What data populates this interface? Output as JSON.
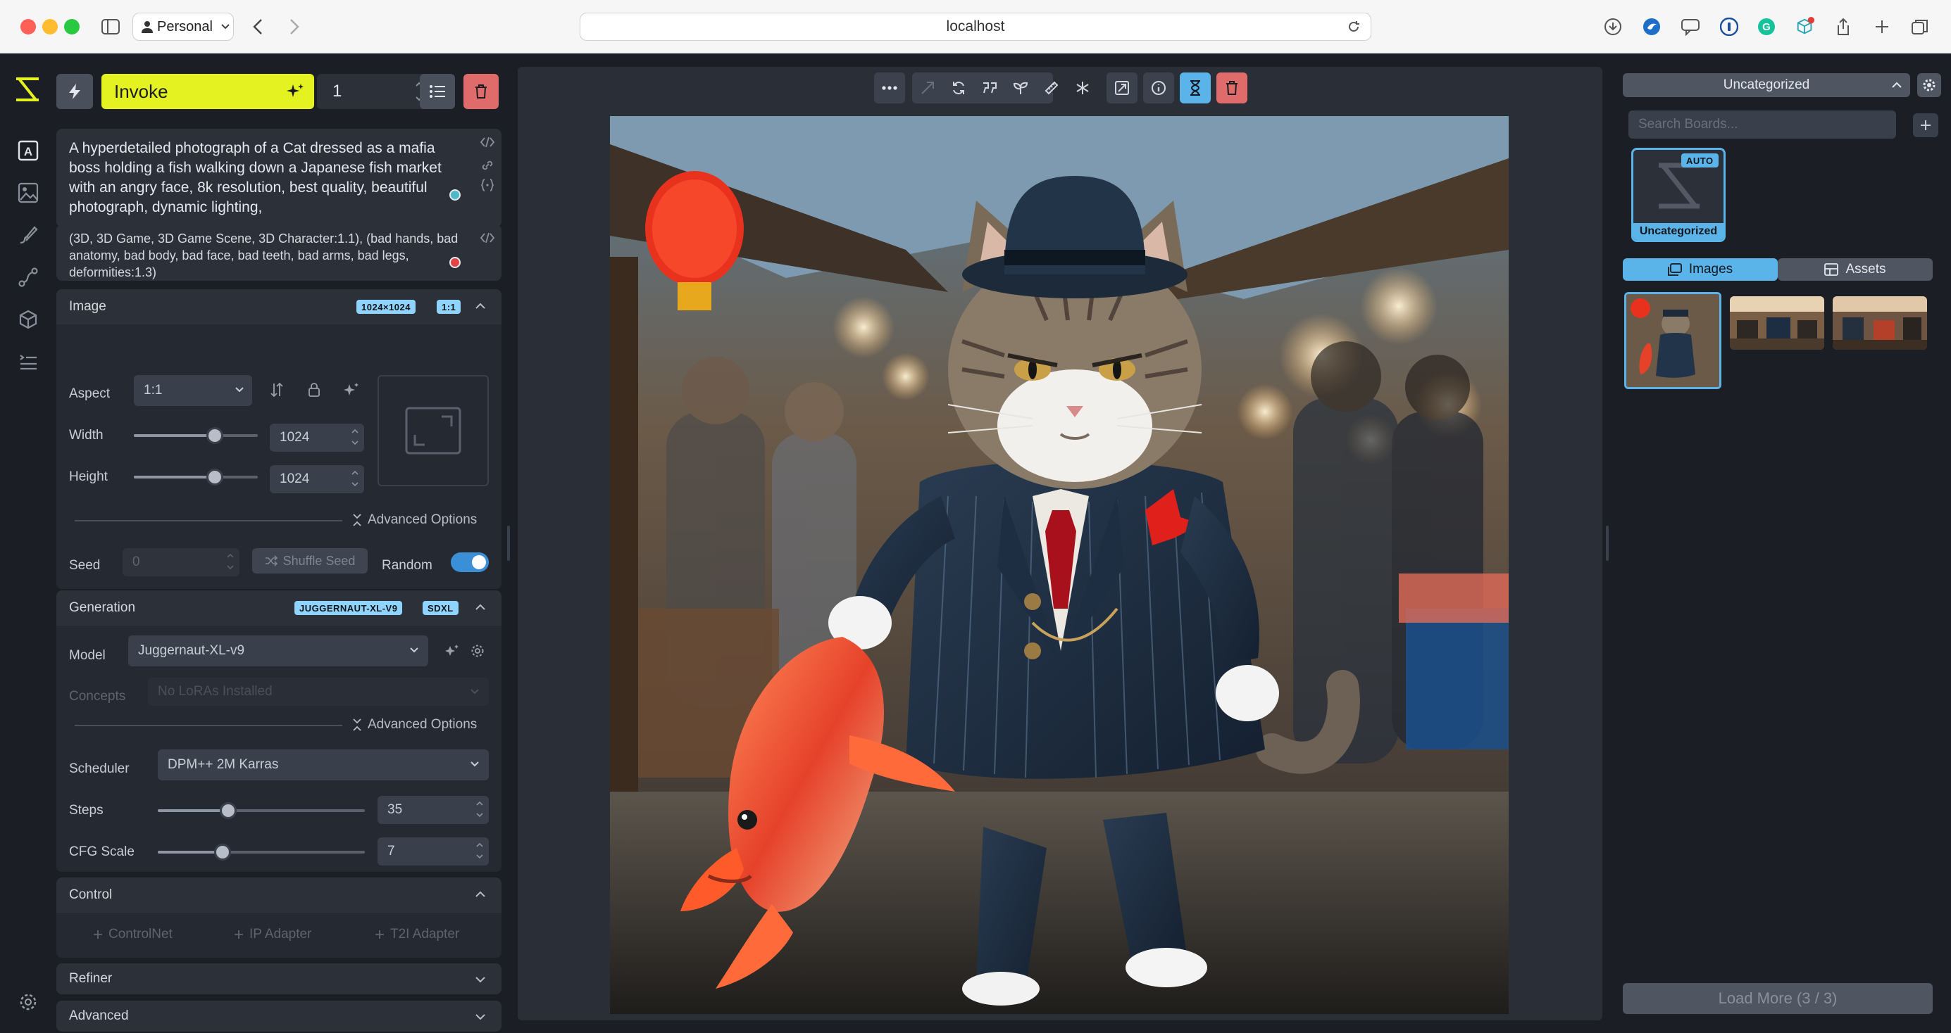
{
  "browser": {
    "profile": "Personal",
    "url": "localhost"
  },
  "toolbar": {
    "invoke_label": "Invoke",
    "iterations": "1"
  },
  "prompt": {
    "positive": "A hyperdetailed photograph of a Cat dressed as a mafia boss holding a fish walking down a Japanese fish market with an angry face, 8k resolution, best quality, beautiful photograph, dynamic lighting,",
    "negative": "(3D, 3D Game, 3D Game Scene, 3D Character:1.1), (bad hands, bad anatomy, bad body, bad face, bad teeth, bad arms, bad legs, deformities:1.3)"
  },
  "image_section": {
    "title": "Image",
    "badges": [
      "1024×1024",
      "1:1"
    ],
    "aspect_label": "Aspect",
    "aspect_value": "1:1",
    "width_label": "Width",
    "width_value": "1024",
    "height_label": "Height",
    "height_value": "1024",
    "advanced_label": "Advanced Options",
    "seed_label": "Seed",
    "seed_value": "0",
    "shuffle_label": "Shuffle Seed",
    "random_label": "Random",
    "random_on": true
  },
  "generation_section": {
    "title": "Generation",
    "badges": [
      "JUGGERNAUT-XL-V9",
      "SDXL"
    ],
    "model_label": "Model",
    "model_value": "Juggernaut-XL-v9",
    "concepts_label": "Concepts",
    "concepts_placeholder": "No LoRAs Installed",
    "advanced_label": "Advanced Options",
    "scheduler_label": "Scheduler",
    "scheduler_value": "DPM++ 2M Karras",
    "steps_label": "Steps",
    "steps_value": "35",
    "cfg_label": "CFG Scale",
    "cfg_value": "7"
  },
  "control_section": {
    "title": "Control",
    "controlnet": "ControlNet",
    "ip_adapter": "IP Adapter",
    "t2i_adapter": "T2I Adapter"
  },
  "refiner_section": {
    "title": "Refiner"
  },
  "advanced_section": {
    "title": "Advanced"
  },
  "gallery": {
    "board_select": "Uncategorized",
    "search_placeholder": "Search Boards...",
    "board_name": "Uncategorized",
    "board_badge": "AUTO",
    "tab_images": "Images",
    "tab_assets": "Assets",
    "load_more": "Load More (3 / 3)"
  },
  "colors": {
    "accent_invoke": "#e4f221",
    "accent_blue": "#5ab4ea",
    "delete_red": "#e06b6b"
  }
}
